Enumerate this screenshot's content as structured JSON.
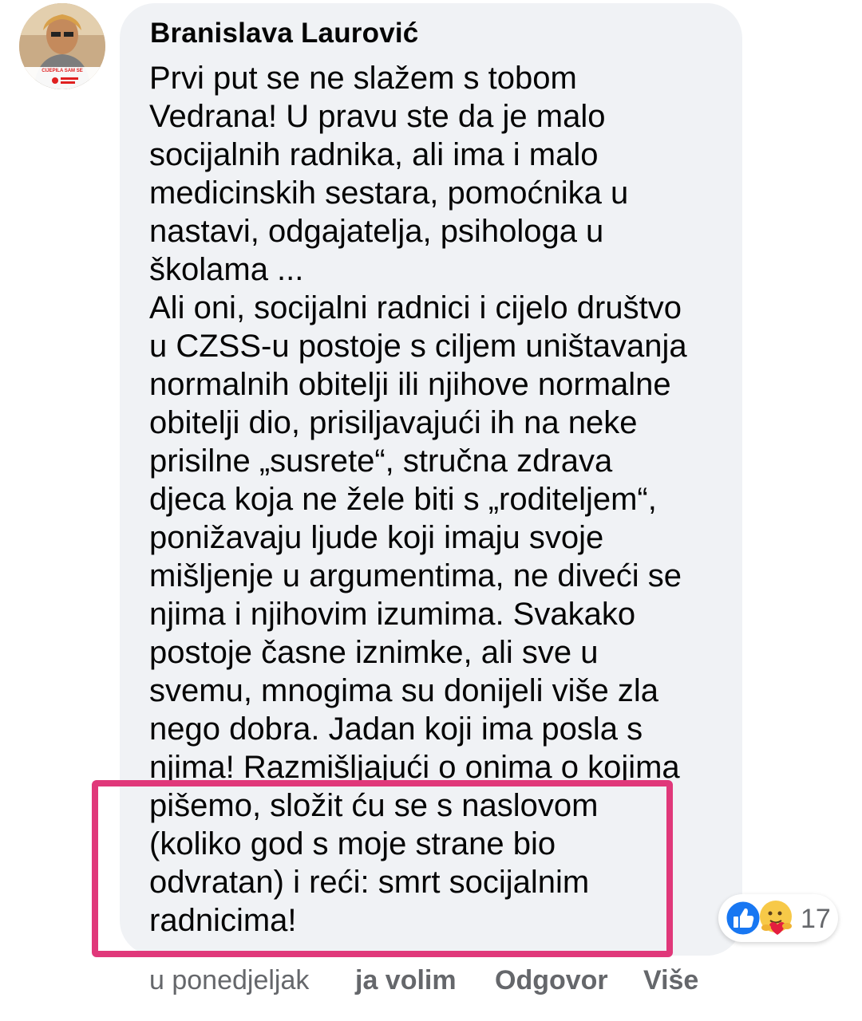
{
  "comment": {
    "author": "Branislava Laurović",
    "lines": [
      "Prvi put se ne slažem s tobom",
      "Vedrana! U pravu ste da je malo",
      "socijalnih radnika, ali ima i malo",
      "medicinskih sestara, pomoćnika u",
      "nastavi, odgajatelja, psihologa u",
      "školama ...",
      "Ali oni, socijalni radnici i cijelo društvo",
      "u CZSS-u postoje s ciljem uništavanja",
      "normalnih obitelji ili njihove normalne",
      "obitelji dio, prisiljavajući ih na neke",
      "prisilne „susrete“, stručna zdrava",
      "djeca koja ne žele biti s „roditeljem“,",
      "ponižavaju ljude koji imaju svoje",
      "mišljenje u argumentima, ne diveći se",
      "njima i njihovim izumima. Svakako",
      "postoje časne iznimke, ali sve u",
      "svemu, mnogima su donijeli više zla",
      "nego dobra. Jadan koji ima posla s",
      "njima! Razmišljajući o onima o kojima",
      "pišemo, složit ću se s naslovom",
      "(koliko god s moje strane bio",
      "odvratan) i reći: smrt socijalnim",
      "radnicima!"
    ],
    "avatar_frame_text": "CIJEPILA SAM SE",
    "reactions": {
      "icons": [
        "like-icon",
        "care-icon"
      ],
      "count": "17"
    },
    "actions": {
      "time": "u ponedjeljak",
      "like": "ja volim",
      "reply": "Odgovor",
      "more": "Više"
    }
  },
  "colors": {
    "bubble_bg": "#f0f2f5",
    "text": "#050505",
    "secondary_text": "#65676b",
    "highlight_border": "#e0387a",
    "like_blue": "#1877f2"
  }
}
